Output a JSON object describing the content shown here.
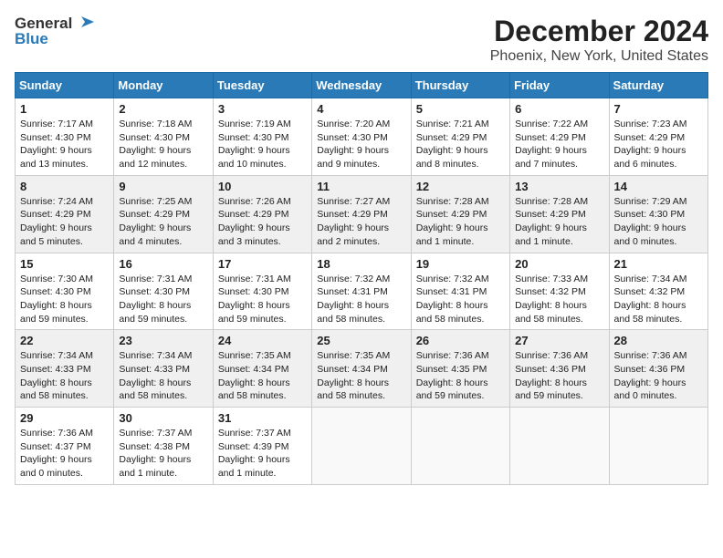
{
  "header": {
    "logo_general": "General",
    "logo_blue": "Blue",
    "title": "December 2024",
    "subtitle": "Phoenix, New York, United States"
  },
  "days_of_week": [
    "Sunday",
    "Monday",
    "Tuesday",
    "Wednesday",
    "Thursday",
    "Friday",
    "Saturday"
  ],
  "weeks": [
    [
      {
        "day": "1",
        "info": "Sunrise: 7:17 AM\nSunset: 4:30 PM\nDaylight: 9 hours and 13 minutes."
      },
      {
        "day": "2",
        "info": "Sunrise: 7:18 AM\nSunset: 4:30 PM\nDaylight: 9 hours and 12 minutes."
      },
      {
        "day": "3",
        "info": "Sunrise: 7:19 AM\nSunset: 4:30 PM\nDaylight: 9 hours and 10 minutes."
      },
      {
        "day": "4",
        "info": "Sunrise: 7:20 AM\nSunset: 4:30 PM\nDaylight: 9 hours and 9 minutes."
      },
      {
        "day": "5",
        "info": "Sunrise: 7:21 AM\nSunset: 4:29 PM\nDaylight: 9 hours and 8 minutes."
      },
      {
        "day": "6",
        "info": "Sunrise: 7:22 AM\nSunset: 4:29 PM\nDaylight: 9 hours and 7 minutes."
      },
      {
        "day": "7",
        "info": "Sunrise: 7:23 AM\nSunset: 4:29 PM\nDaylight: 9 hours and 6 minutes."
      }
    ],
    [
      {
        "day": "8",
        "info": "Sunrise: 7:24 AM\nSunset: 4:29 PM\nDaylight: 9 hours and 5 minutes."
      },
      {
        "day": "9",
        "info": "Sunrise: 7:25 AM\nSunset: 4:29 PM\nDaylight: 9 hours and 4 minutes."
      },
      {
        "day": "10",
        "info": "Sunrise: 7:26 AM\nSunset: 4:29 PM\nDaylight: 9 hours and 3 minutes."
      },
      {
        "day": "11",
        "info": "Sunrise: 7:27 AM\nSunset: 4:29 PM\nDaylight: 9 hours and 2 minutes."
      },
      {
        "day": "12",
        "info": "Sunrise: 7:28 AM\nSunset: 4:29 PM\nDaylight: 9 hours and 1 minute."
      },
      {
        "day": "13",
        "info": "Sunrise: 7:28 AM\nSunset: 4:29 PM\nDaylight: 9 hours and 1 minute."
      },
      {
        "day": "14",
        "info": "Sunrise: 7:29 AM\nSunset: 4:30 PM\nDaylight: 9 hours and 0 minutes."
      }
    ],
    [
      {
        "day": "15",
        "info": "Sunrise: 7:30 AM\nSunset: 4:30 PM\nDaylight: 8 hours and 59 minutes."
      },
      {
        "day": "16",
        "info": "Sunrise: 7:31 AM\nSunset: 4:30 PM\nDaylight: 8 hours and 59 minutes."
      },
      {
        "day": "17",
        "info": "Sunrise: 7:31 AM\nSunset: 4:30 PM\nDaylight: 8 hours and 59 minutes."
      },
      {
        "day": "18",
        "info": "Sunrise: 7:32 AM\nSunset: 4:31 PM\nDaylight: 8 hours and 58 minutes."
      },
      {
        "day": "19",
        "info": "Sunrise: 7:32 AM\nSunset: 4:31 PM\nDaylight: 8 hours and 58 minutes."
      },
      {
        "day": "20",
        "info": "Sunrise: 7:33 AM\nSunset: 4:32 PM\nDaylight: 8 hours and 58 minutes."
      },
      {
        "day": "21",
        "info": "Sunrise: 7:34 AM\nSunset: 4:32 PM\nDaylight: 8 hours and 58 minutes."
      }
    ],
    [
      {
        "day": "22",
        "info": "Sunrise: 7:34 AM\nSunset: 4:33 PM\nDaylight: 8 hours and 58 minutes."
      },
      {
        "day": "23",
        "info": "Sunrise: 7:34 AM\nSunset: 4:33 PM\nDaylight: 8 hours and 58 minutes."
      },
      {
        "day": "24",
        "info": "Sunrise: 7:35 AM\nSunset: 4:34 PM\nDaylight: 8 hours and 58 minutes."
      },
      {
        "day": "25",
        "info": "Sunrise: 7:35 AM\nSunset: 4:34 PM\nDaylight: 8 hours and 58 minutes."
      },
      {
        "day": "26",
        "info": "Sunrise: 7:36 AM\nSunset: 4:35 PM\nDaylight: 8 hours and 59 minutes."
      },
      {
        "day": "27",
        "info": "Sunrise: 7:36 AM\nSunset: 4:36 PM\nDaylight: 8 hours and 59 minutes."
      },
      {
        "day": "28",
        "info": "Sunrise: 7:36 AM\nSunset: 4:36 PM\nDaylight: 9 hours and 0 minutes."
      }
    ],
    [
      {
        "day": "29",
        "info": "Sunrise: 7:36 AM\nSunset: 4:37 PM\nDaylight: 9 hours and 0 minutes."
      },
      {
        "day": "30",
        "info": "Sunrise: 7:37 AM\nSunset: 4:38 PM\nDaylight: 9 hours and 1 minute."
      },
      {
        "day": "31",
        "info": "Sunrise: 7:37 AM\nSunset: 4:39 PM\nDaylight: 9 hours and 1 minute."
      },
      null,
      null,
      null,
      null
    ]
  ]
}
